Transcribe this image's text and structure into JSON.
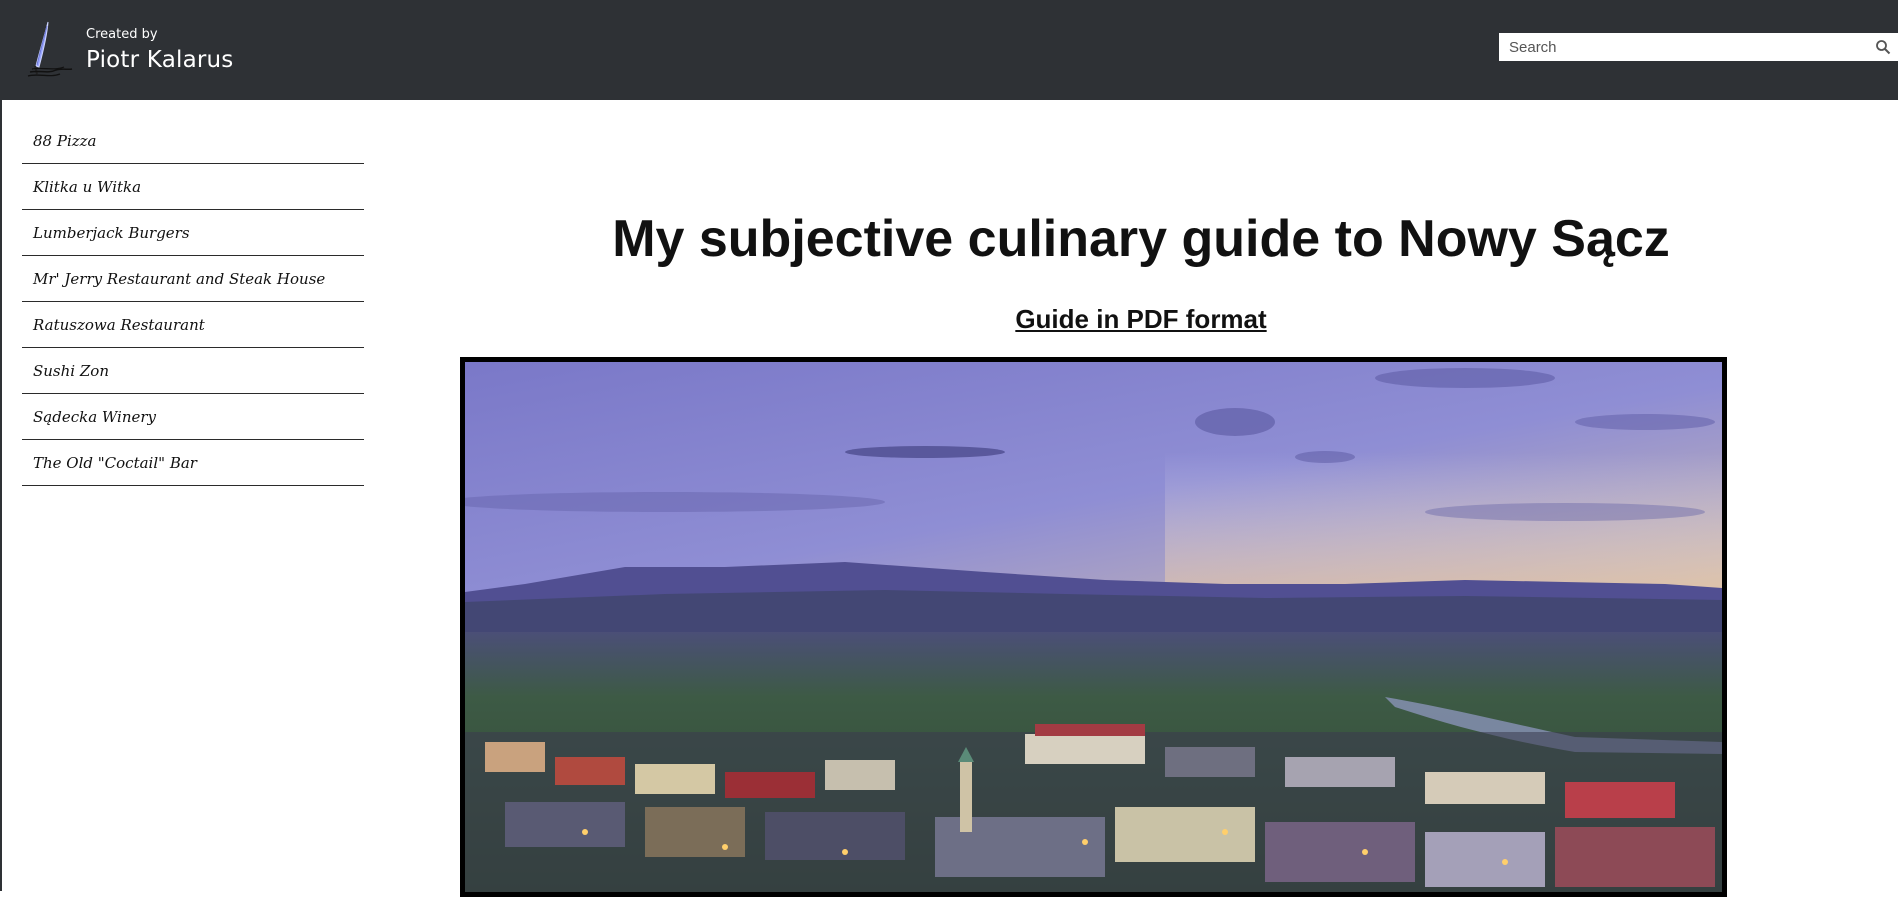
{
  "header": {
    "created_by": "Created by",
    "author": "Piotr Kalarus",
    "search_placeholder": "Search",
    "logo_icon": "quill-pen-icon",
    "search_icon": "search-icon"
  },
  "sidebar": {
    "items": [
      {
        "label": "88 Pizza"
      },
      {
        "label": "Klitka u Witka"
      },
      {
        "label": "Lumberjack Burgers"
      },
      {
        "label": "Mr' Jerry Restaurant and Steak House"
      },
      {
        "label": "Ratuszowa Restaurant"
      },
      {
        "label": "Sushi Zon"
      },
      {
        "label": "Sądecka Winery"
      },
      {
        "label": "The Old \"Coctail\" Bar"
      }
    ]
  },
  "main": {
    "title": "My subjective culinary guide to Nowy Sącz",
    "pdf_link": "Guide in PDF format"
  },
  "colors": {
    "header_bg": "#2e3135",
    "page_bg": "#ffffff",
    "text": "#111111"
  }
}
